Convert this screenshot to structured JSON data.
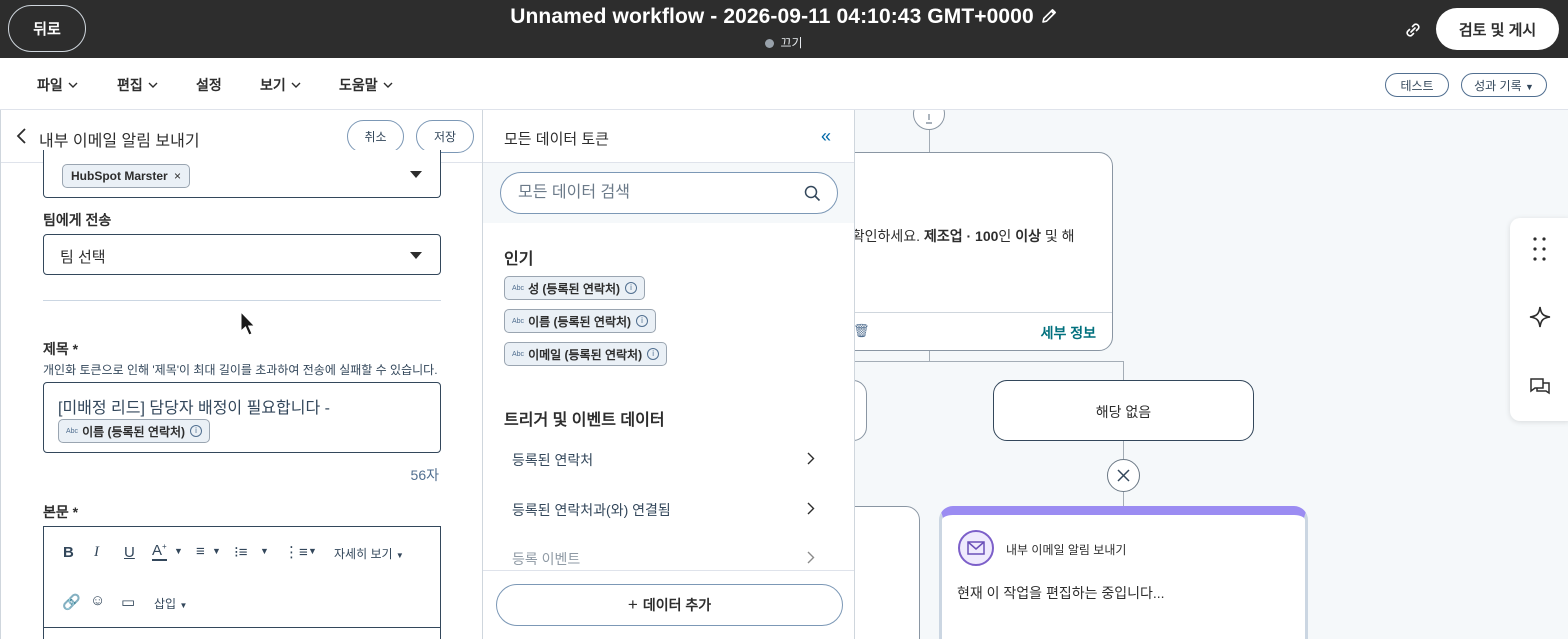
{
  "topbar": {
    "back_label": "뒤로",
    "workflow_title": "Unnamed workflow - 2026-09-11 04:10:43 GMT+0000",
    "status_text": "끄기",
    "review_publish_label": "검토 및 게시"
  },
  "menu": {
    "items": [
      {
        "label": "파일"
      },
      {
        "label": "편집"
      },
      {
        "label": "설정"
      },
      {
        "label": "보기"
      },
      {
        "label": "도움말"
      }
    ],
    "test_label": "테스트",
    "performance_label": "성과 기록"
  },
  "left_panel": {
    "title": "내부 이메일 알림 보내기",
    "cancel_label": "취소",
    "save_label": "저장",
    "user_tag": "HubSpot Marster",
    "team_label": "팀에게 전송",
    "team_value": "팀 선택",
    "subject_label": "제목 *",
    "subject_warning": "개인화 토큰으로 인해 '제목'이 최대 길이를 초과하여 전송에 실패할 수 있습니다.",
    "subject_text": "[미배정 리드] 담당자 배정이 필요합니다 -",
    "subject_token": "이름 (등록된 연락처)",
    "char_count": "56자",
    "body_label": "본문 *",
    "toolbar": {
      "more_label": "자세히 보기",
      "insert_label": "삽입"
    }
  },
  "data_panel": {
    "title": "모든 데이터 토큰",
    "search_placeholder": "모든 데이터 검색",
    "popular_title": "인기",
    "popular_tokens": [
      {
        "label": "성 (등록된 연락처)"
      },
      {
        "label": "이름 (등록된 연락처)"
      },
      {
        "label": "이메일 (등록된 연락처)"
      }
    ],
    "trigger_title": "트리거 및 이벤트 데이터",
    "trigger_items": [
      {
        "label": "등록된 연락처"
      },
      {
        "label": "등록된 연락처과(와) 연결됨"
      },
      {
        "label": "등록 이벤트"
      }
    ],
    "add_data_label": "데이터 추가"
  },
  "canvas": {
    "card_text_plain": ". 확인하세요. ",
    "card_text_bold1": "제조업 · 100",
    "card_text_mid": "인 ",
    "card_text_bold2": "이상",
    "card_text_end": " 및 해",
    "details_label": "세부 정보",
    "none_branch_label": "해당 없음",
    "action_title": "내부 이메일 알림 보내기",
    "action_status": "현재 이 작업을 편집하는 중입니다..."
  },
  "colors": {
    "topbar_bg": "#2d2d2d",
    "accent_link": "#00707d",
    "selected_card": "#9b8cf2",
    "text_primary": "#33475b"
  },
  "icons": {
    "edit_title": "pencil-icon",
    "status": "status-dot",
    "share": "link-icon",
    "search": "search-icon",
    "collapse": "double-chevron-left-icon",
    "add_data": "plus-icon",
    "email_action": "envelope-icon",
    "rail": [
      "grid-dots-icon",
      "sparkle-icon",
      "chat-icon"
    ]
  }
}
